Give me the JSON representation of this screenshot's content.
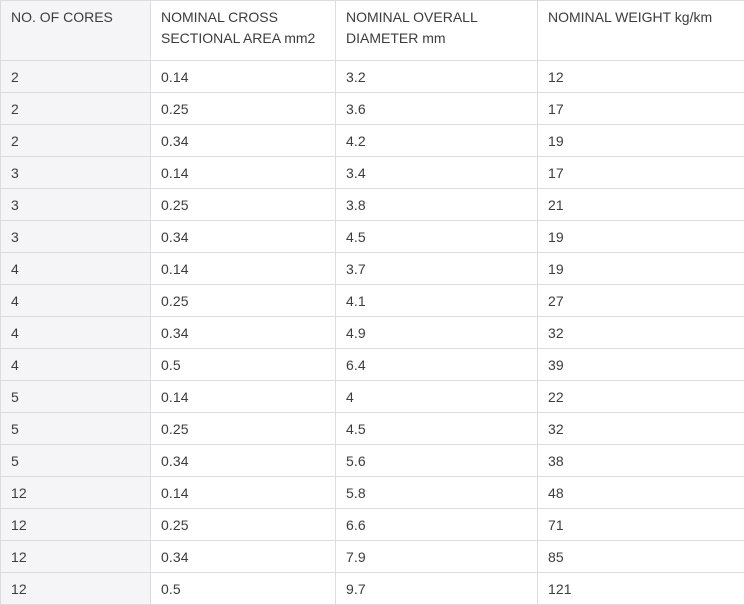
{
  "table": {
    "headers": [
      "NO. OF CORES",
      "NOMINAL CROSS SECTIONAL AREA mm2",
      "NOMINAL OVERALL DIAMETER mm",
      "NOMINAL WEIGHT kg/km"
    ],
    "rows": [
      [
        "2",
        "0.14",
        "3.2",
        "12"
      ],
      [
        "2",
        "0.25",
        "3.6",
        "17"
      ],
      [
        "2",
        "0.34",
        "4.2",
        "19"
      ],
      [
        "3",
        "0.14",
        "3.4",
        "17"
      ],
      [
        "3",
        "0.25",
        "3.8",
        "21"
      ],
      [
        "3",
        "0.34",
        "4.5",
        "19"
      ],
      [
        "4",
        "0.14",
        "3.7",
        "19"
      ],
      [
        "4",
        "0.25",
        "4.1",
        "27"
      ],
      [
        "4",
        "0.34",
        "4.9",
        "32"
      ],
      [
        "4",
        "0.5",
        "6.4",
        "39"
      ],
      [
        "5",
        "0.14",
        "4",
        "22"
      ],
      [
        "5",
        "0.25",
        "4.5",
        "32"
      ],
      [
        "5",
        "0.34",
        "5.6",
        "38"
      ],
      [
        "12",
        "0.14",
        "5.8",
        "48"
      ],
      [
        "12",
        "0.25",
        "6.6",
        "71"
      ],
      [
        "12",
        "0.34",
        "7.9",
        "85"
      ],
      [
        "12",
        "0.5",
        "9.7",
        "121"
      ]
    ]
  }
}
